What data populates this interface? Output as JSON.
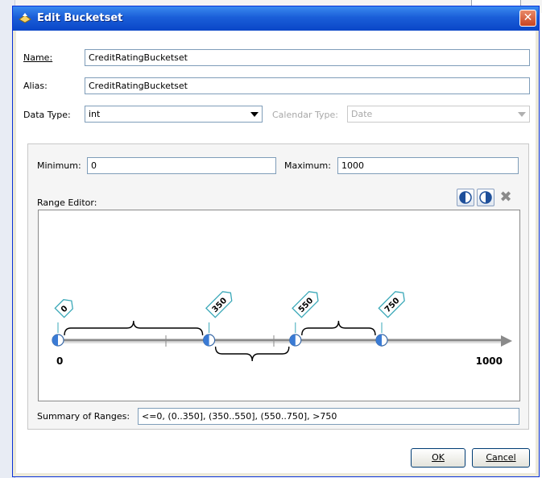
{
  "dialog": {
    "title": "Edit Bucketset",
    "close_glyph": "✕"
  },
  "name": {
    "label": "Name:",
    "value": "CreditRatingBucketset"
  },
  "alias": {
    "label": "Alias:",
    "value": "CreditRatingBucketset"
  },
  "data_type": {
    "label": "Data Type:",
    "value": "int"
  },
  "calendar_type": {
    "label": "Calendar Type:",
    "value": "Date",
    "enabled": false
  },
  "minimum": {
    "label": "Minimum:",
    "value": "0"
  },
  "maximum": {
    "label": "Maximum:",
    "value": "1000"
  },
  "range_editor": {
    "label": "Range Editor:",
    "axis_start_label": "0",
    "axis_end_label": "1000",
    "range_min": 0,
    "range_max": 1000,
    "boundaries": [
      {
        "value": 0,
        "label": "0"
      },
      {
        "value": 350,
        "label": "350"
      },
      {
        "value": 550,
        "label": "550"
      },
      {
        "value": 750,
        "label": "750"
      }
    ],
    "toolbar_icons": [
      "split-left-icon",
      "split-right-icon",
      "delete-icon"
    ]
  },
  "summary": {
    "label": "Summary of Ranges:",
    "value": "<=0, (0..350], (350..550], (550..750], >750"
  },
  "buttons": {
    "ok": "OK",
    "cancel": "Cancel"
  },
  "colors": {
    "titlebar": "#0a46c8",
    "marker": "#3a7bd5",
    "close": "#c74422"
  }
}
